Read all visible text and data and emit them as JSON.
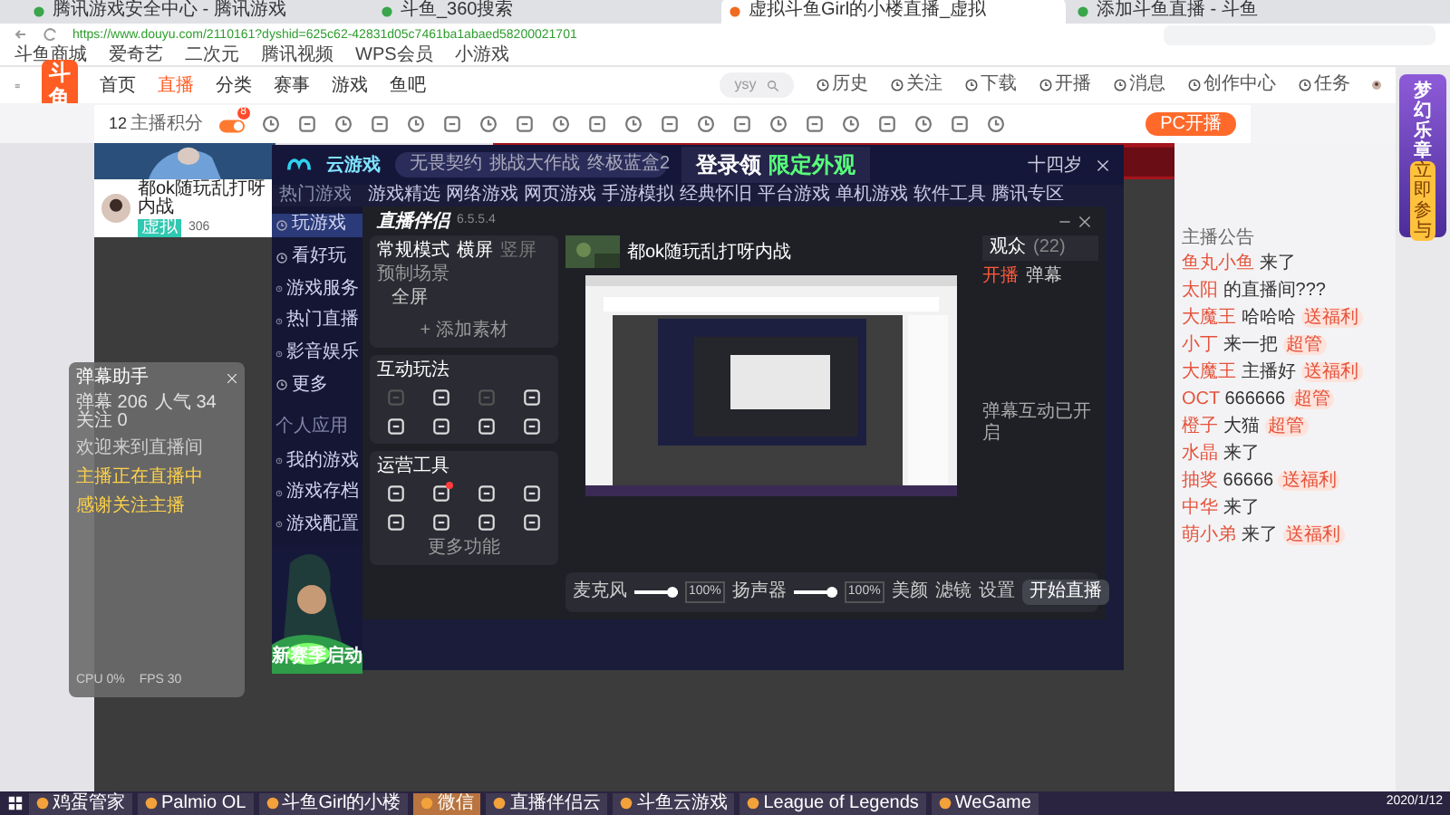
{
  "browser": {
    "tabs": [
      {
        "label": "腾讯游戏安全中心 - 腾讯游戏",
        "selected": false
      },
      {
        "label": "斗鱼_360搜索",
        "selected": false
      },
      {
        "label": "虚拟斗鱼Girl的小楼直播_虚拟",
        "selected": true
      },
      {
        "label": "添加斗鱼直播 - 斗鱼",
        "selected": false
      }
    ],
    "url": "https://www.douyu.com/2110161?dyshid=625c62-42831d05c7461ba1abaed58200021701",
    "bookmarks": [
      "斗鱼商城",
      "爱奇艺",
      "二次元",
      "腾讯视频",
      "WPS会员",
      "小游戏"
    ]
  },
  "site": {
    "logo": "斗鱼",
    "nav": [
      {
        "label": "首页",
        "selected": false
      },
      {
        "label": "直播",
        "selected": true
      },
      {
        "label": "分类",
        "selected": false
      },
      {
        "label": "赛事",
        "selected": false
      },
      {
        "label": "游戏",
        "selected": false
      },
      {
        "label": "鱼吧",
        "selected": false
      }
    ],
    "search_placeholder": "ysy",
    "header_icons": [
      "历史",
      "关注",
      "下载",
      "开播",
      "消息",
      "创作中心",
      "任务"
    ]
  },
  "toolbar": {
    "points": "12",
    "points_label": "主播积分",
    "badge": "8",
    "pc_button": "PC开播"
  },
  "streamer": {
    "name": "都ok随玩乱打呀内战",
    "tag": "虚拟",
    "count": "306"
  },
  "cloud": {
    "logo": "云游戏",
    "chips": [
      "无畏契约",
      "挑战大作战",
      "终极蓝盒2"
    ],
    "promo": "登录领",
    "promo_highlight": "限定外观",
    "user": "十四岁",
    "section": "热门游戏",
    "nav": [
      "游戏精选",
      "网络游戏",
      "网页游戏",
      "手游模拟",
      "经典怀旧",
      "平台游戏",
      "单机游戏",
      "软件工具",
      "腾讯专区"
    ],
    "sidebar": [
      {
        "label": "玩游戏",
        "selected": true
      },
      {
        "label": "看好玩",
        "selected": false
      },
      {
        "label": "游戏服务",
        "selected": false
      },
      {
        "label": "热门直播",
        "selected": false
      },
      {
        "label": "影音娱乐",
        "selected": false
      },
      {
        "label": "更多",
        "selected": false
      }
    ],
    "personal_title": "个人应用",
    "personal": [
      {
        "label": "我的游戏",
        "selected": false
      },
      {
        "label": "游戏存档",
        "selected": false
      },
      {
        "label": "游戏配置",
        "selected": false
      }
    ],
    "art_caption": "新赛季启动"
  },
  "companion": {
    "title": "直播伴侣",
    "version": "6.5.5.4",
    "mode": "常规模式",
    "orientation": [
      {
        "label": "横屏",
        "selected": true
      },
      {
        "label": "竖屏",
        "selected": false
      }
    ],
    "scene_title": "预制场景",
    "scene_item": "全屏",
    "add_source": "+ 添加素材",
    "interactive_title": "互动玩法",
    "interactive": [
      {
        "disabled": true,
        "badge": false
      },
      {
        "disabled": false,
        "badge": false
      },
      {
        "disabled": true,
        "badge": false
      },
      {
        "disabled": false,
        "badge": false
      },
      {
        "disabled": false,
        "badge": false
      },
      {
        "disabled": false,
        "badge": false
      },
      {
        "disabled": false,
        "badge": false
      },
      {
        "disabled": false,
        "badge": false
      }
    ],
    "ops_title": "运营工具",
    "ops": [
      {
        "disabled": false,
        "badge": false
      },
      {
        "disabled": false,
        "badge": true
      },
      {
        "disabled": false,
        "badge": false
      },
      {
        "disabled": false,
        "badge": false
      },
      {
        "disabled": false,
        "badge": false
      },
      {
        "disabled": false,
        "badge": false
      },
      {
        "disabled": false,
        "badge": false
      },
      {
        "disabled": false,
        "badge": false
      }
    ],
    "more": "更多功能",
    "stream_title": "都ok随玩乱打呀内战",
    "audio": [
      {
        "name": "麦克风",
        "level": 1,
        "reading": "100%"
      },
      {
        "name": "扬声器",
        "level": 1,
        "reading": "100%"
      }
    ],
    "actions": [
      "美颜",
      "滤镜",
      "设置"
    ],
    "start": "开始直播",
    "right_tabs": [
      {
        "label": "观众",
        "selected": true
      },
      {
        "label": "(22)",
        "selected": false
      }
    ],
    "right_actions": [
      "开播",
      "弹幕"
    ],
    "notice": "弹幕互动已开启"
  },
  "danmu": {
    "title": "弹幕助手",
    "stats": [
      "弹幕 206",
      "人气 34",
      "关注 0"
    ],
    "messages": [
      {
        "text": "欢迎来到直播间",
        "highlight": false
      },
      {
        "text": "主播正在直播中",
        "highlight": true
      },
      {
        "text": "感谢关注主播",
        "highlight": true
      }
    ],
    "footer": [
      "CPU 0%",
      "FPS 30"
    ]
  },
  "chat": {
    "notice": "主播公告",
    "messages": [
      {
        "name": "鱼丸小鱼",
        "text": "来了"
      },
      {
        "name": "太阳",
        "text": "的直播间???"
      },
      {
        "name": "大魔王",
        "text": "哈哈哈",
        "badge": "送福利"
      },
      {
        "name": "小丁",
        "text": "来一把",
        "badge": "超管"
      },
      {
        "name": "大魔王",
        "text": "主播好",
        "badge": "送福利"
      },
      {
        "name": "OCT",
        "text": "666666",
        "badge": "超管"
      },
      {
        "name": "橙子",
        "text": "大猫",
        "badge": "超管"
      },
      {
        "name": "水晶",
        "text": "来了"
      },
      {
        "name": "抽奖",
        "text": "66666",
        "badge": "送福利"
      },
      {
        "name": "中华",
        "text": "来了"
      },
      {
        "name": "萌小弟",
        "text": "来了",
        "badge": "送福利"
      }
    ]
  },
  "rail": {
    "ad": "梦幻乐章",
    "ad_button": "立即参与"
  },
  "taskbar": {
    "items": [
      {
        "label": "鸡蛋管家",
        "selected": false
      },
      {
        "label": "Palmio OL",
        "selected": false
      },
      {
        "label": "斗鱼Girl的小楼",
        "selected": false
      },
      {
        "label": "微信",
        "selected": true
      },
      {
        "label": "直播伴侣云",
        "selected": false
      },
      {
        "label": "斗鱼云游戏",
        "selected": false
      },
      {
        "label": "League of Legends",
        "selected": false
      },
      {
        "label": "WeGame",
        "selected": false
      }
    ],
    "date": "2020/1/12"
  }
}
